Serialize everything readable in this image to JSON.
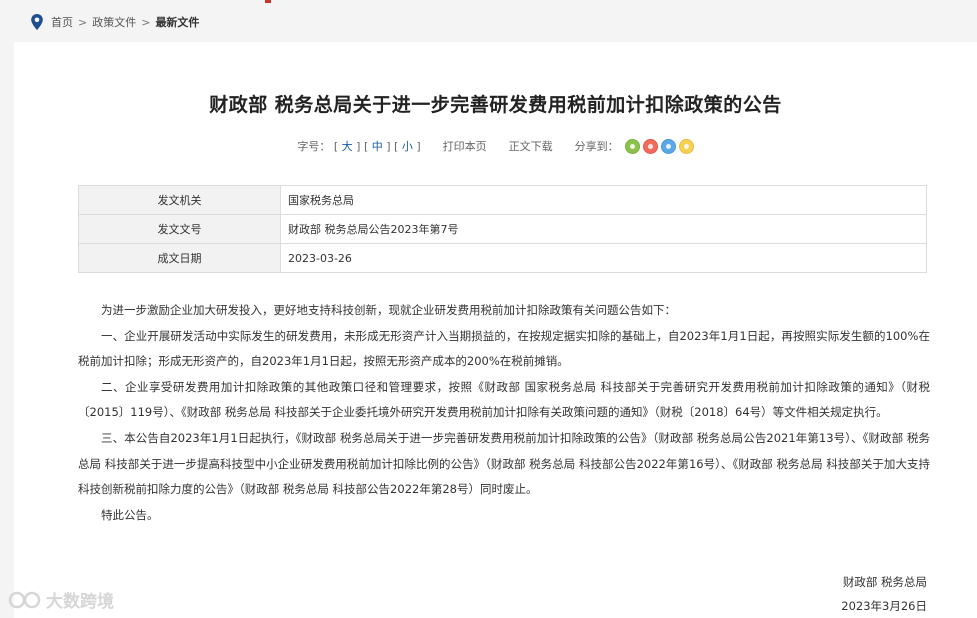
{
  "breadcrumb": {
    "home": "首页",
    "sep": ">",
    "section": "政策文件",
    "current": "最新文件"
  },
  "article": {
    "title": "财政部 税务总局关于进一步完善研发费用税前加计扣除政策的公告",
    "tools": {
      "font_label": "字号：",
      "bracket_open": "[",
      "bracket_close": "]",
      "size_large": "大",
      "size_medium": "中",
      "size_small": "小",
      "print": "打印本页",
      "download": "正文下载",
      "share": "分享到："
    },
    "meta": [
      {
        "key": "发文机关",
        "value": "国家税务总局"
      },
      {
        "key": "发文文号",
        "value": "财政部 税务总局公告2023年第7号"
      },
      {
        "key": "成文日期",
        "value": "2023-03-26"
      }
    ],
    "paragraphs": [
      "为进一步激励企业加大研发投入，更好地支持科技创新，现就企业研发费用税前加计扣除政策有关问题公告如下：",
      "一、企业开展研发活动中实际发生的研发费用，未形成无形资产计入当期损益的，在按规定据实扣除的基础上，自2023年1月1日起，再按照实际发生额的100%在税前加计扣除；形成无形资产的，自2023年1月1日起，按照无形资产成本的200%在税前摊销。",
      "二、企业享受研发费用加计扣除政策的其他政策口径和管理要求，按照《财政部 国家税务总局 科技部关于完善研究开发费用税前加计扣除政策的通知》（财税〔2015〕119号）、《财政部 税务总局 科技部关于企业委托境外研究开发费用税前加计扣除有关政策问题的通知》（财税〔2018〕64号）等文件相关规定执行。",
      "三、本公告自2023年1月1日起执行，《财政部 税务总局关于进一步完善研发费用税前加计扣除政策的公告》（财政部 税务总局公告2021年第13号）、《财政部 税务总局 科技部关于进一步提高科技型中小企业研发费用税前加计扣除比例的公告》（财政部 税务总局 科技部公告2022年第16号）、《财政部 税务总局 科技部关于加大支持科技创新税前扣除力度的公告》（财政部 税务总局 科技部公告2022年第28号）同时废止。",
      "特此公告。"
    ],
    "signature": {
      "issuer": "财政部 税务总局",
      "date": "2023年3月26日"
    }
  },
  "watermark": {
    "text": "大数跨境"
  },
  "colors": {
    "link": "#1a5aa8",
    "table_key_bg": "#f2f2f2",
    "page_bg": "#f4f4f4"
  }
}
